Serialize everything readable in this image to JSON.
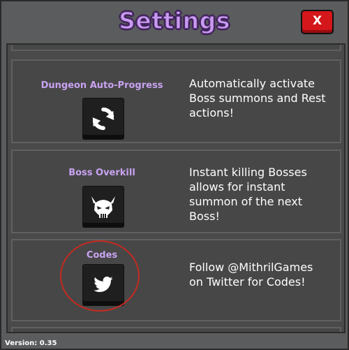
{
  "header": {
    "title": "Settings",
    "close_label": "X"
  },
  "settings": [
    {
      "label": "Dungeon Auto-Progress",
      "icon": "refresh-icon",
      "description": "Automatically activate Boss summons and Rest actions!"
    },
    {
      "label": "Boss Overkill",
      "icon": "demon-skull-icon",
      "description": "Instant killing Bosses allows for instant summon of the next Boss!"
    },
    {
      "label": "Codes",
      "icon": "twitter-bird-icon",
      "description": "Follow @MithrilGames on Twitter for Codes!"
    }
  ],
  "footer": {
    "version": "Version: 0.35"
  },
  "colors": {
    "title": "#c99bf0",
    "label": "#c8a3f0",
    "close_button": "#d4171b",
    "highlight": "#c62a20"
  }
}
